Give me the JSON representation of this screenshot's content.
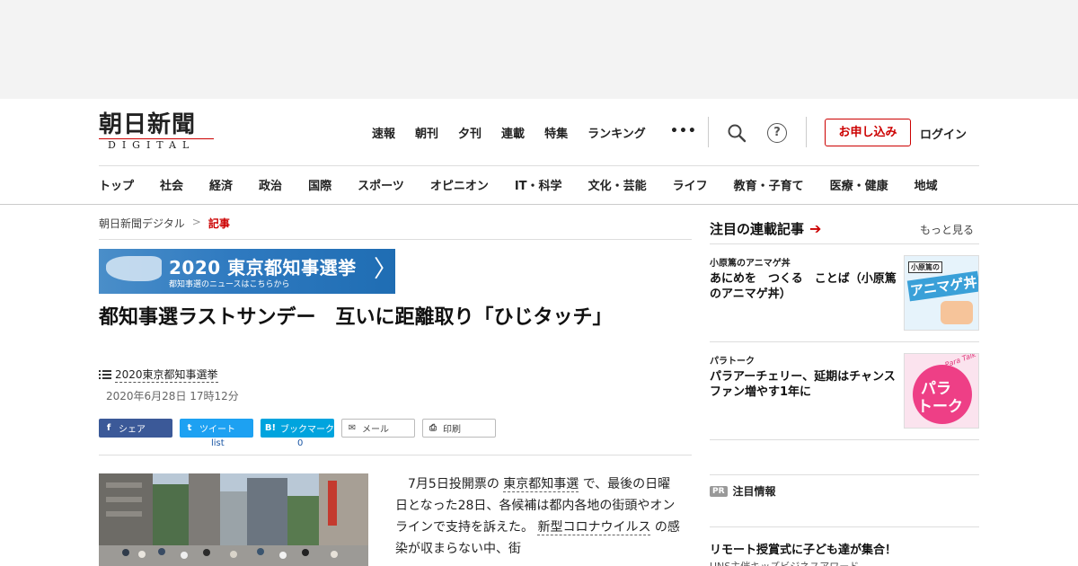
{
  "logo": {
    "main": "朝日新聞",
    "sub": "DIGITAL"
  },
  "topnav": [
    "速報",
    "朝刊",
    "夕刊",
    "連載",
    "特集",
    "ランキング"
  ],
  "topnav_more": "•••",
  "help_glyph": "?",
  "subscribe_label": "お申し込み",
  "login_label": "ログイン",
  "catnav": [
    "トップ",
    "社会",
    "経済",
    "政治",
    "国際",
    "スポーツ",
    "オピニオン",
    "IT・科学",
    "文化・芸能",
    "ライフ",
    "教育・子育て",
    "医療・健康",
    "地域"
  ],
  "breadcrumb": {
    "home": "朝日新聞デジタル",
    "sep": ">",
    "current": "記事"
  },
  "banner": {
    "title": "2020 東京都知事選挙",
    "sub": "都知事選のニュースはこちらから",
    "arrow": "〉"
  },
  "article": {
    "title": "都知事選ラストサンデー　互いに距離取り「ひじタッチ」",
    "series": "2020東京都知事選挙",
    "date": "2020年6月28日 17時12分",
    "body_parts": [
      "　7月5日投開票の ",
      "東京都知事選",
      " で、最後の日曜日となった28日、各候補は都内各地の街頭やオンラインで支持を訴えた。 ",
      "新型コロナウイルス",
      " の感染が収まらない中、街"
    ]
  },
  "share": {
    "facebook": {
      "icon": "f",
      "label": "シェア"
    },
    "twitter": {
      "icon": "t",
      "label": "ツイート",
      "count": "list"
    },
    "hatena": {
      "icon": "B!",
      "label": "ブックマーク",
      "count": "0"
    },
    "mail": {
      "icon": "✉",
      "label": "メール"
    },
    "print": {
      "icon": "⎙",
      "label": "印刷"
    }
  },
  "sidebar": {
    "heading": "注目の連載記事",
    "arrow": "➔",
    "more": "もっと見る",
    "items": [
      {
        "category": "小原篤のアニマゲ丼",
        "title": "あにめを　つくる　ことば（小原篤のアニマゲ丼）",
        "thumb_text1": "小原篤の",
        "thumb_text2": "アニマゲ丼"
      },
      {
        "category": "パラトーク",
        "title": "パラアーチェリー、延期はチャンス　ファン増やす1年に",
        "thumb_text1": "Para Talk",
        "thumb_text2": "パラ",
        "thumb_text3": "トーク"
      }
    ],
    "pr_badge": "PR",
    "pr_heading": "注目情報",
    "pr_title": "リモート授賞式に子ども達が集合！",
    "pr_sub": "UNS主催キッズビジネスアワード"
  },
  "colors": {
    "brand_red": "#cc0000",
    "facebook": "#3b5998",
    "twitter": "#1da1f2",
    "hatena": "#00a4de"
  }
}
